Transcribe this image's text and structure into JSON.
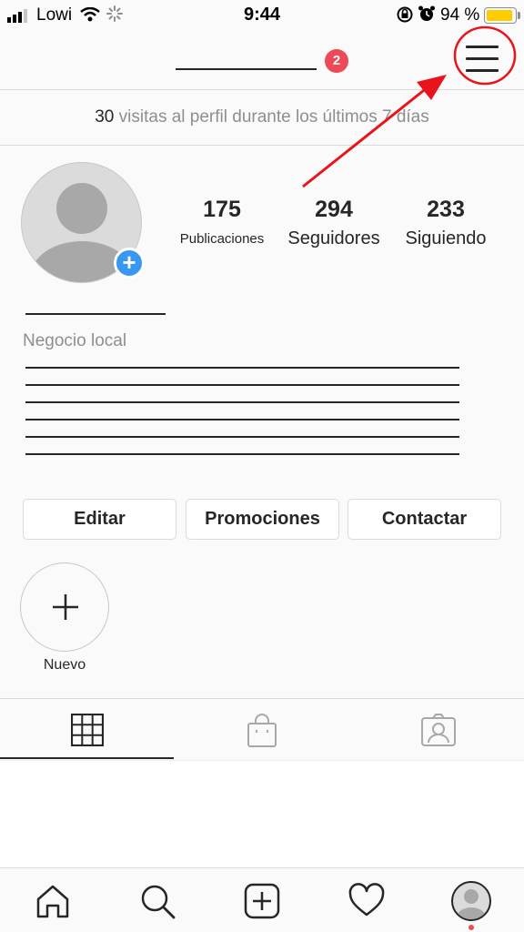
{
  "status_bar": {
    "carrier": "Lowi",
    "time": "9:44",
    "battery_percent": "94 %",
    "battery_level": 0.94,
    "battery_color": "#ffcc00"
  },
  "header": {
    "notification_count": "2",
    "menu_icon": "hamburger-menu-icon"
  },
  "visits_banner": {
    "count": "30",
    "text": " visitas al perfil durante los últimos 7 días"
  },
  "profile": {
    "stats": [
      {
        "value": "175",
        "label": "Publicaciones"
      },
      {
        "value": "294",
        "label": "Seguidores"
      },
      {
        "value": "233",
        "label": "Siguiendo"
      }
    ],
    "category": "Negocio local"
  },
  "actions": {
    "edit": "Editar",
    "promotions": "Promociones",
    "contact": "Contactar"
  },
  "highlights": {
    "new_label": "Nuevo"
  },
  "tabs": [
    {
      "icon": "grid-icon",
      "active": true
    },
    {
      "icon": "shopping-bag-icon",
      "active": false
    },
    {
      "icon": "tagged-person-icon",
      "active": false
    }
  ],
  "bottom_nav": [
    "home-icon",
    "search-icon",
    "add-post-icon",
    "heart-icon",
    "profile-avatar"
  ],
  "colors": {
    "accent_blue": "#3897f0",
    "badge_red": "#ed4956",
    "annotation_red": "#e8141c"
  }
}
